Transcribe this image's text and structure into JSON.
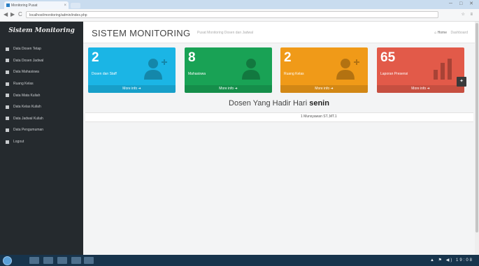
{
  "browser": {
    "tab_title": "Monitoring Pusat",
    "tab_close": "×",
    "url": "localhost/monitoring/admin/index.php",
    "window_controls": "─ □ ✕",
    "nav_back": "◀",
    "nav_forward": "▶",
    "reload": "C",
    "addr_right_icons": "☆ ≡"
  },
  "sidebar": {
    "brand": "Sistem Monitoring",
    "items": [
      {
        "label": "Data Dosen Tetap"
      },
      {
        "label": "Data Dosen Jadwal"
      },
      {
        "label": "Data Mahasiswa"
      },
      {
        "label": "Ruang Kelas"
      },
      {
        "label": "Data Mata Kuliah"
      },
      {
        "label": "Data Kelas Kuliah"
      },
      {
        "label": "Data Jadwal Kuliah"
      },
      {
        "label": "Data Pengumuman"
      },
      {
        "label": "Logout"
      }
    ]
  },
  "header": {
    "title": "SISTEM MONITORING",
    "subtitle": "Pusat Monitoring Dosen dan Jadwal",
    "home_link": "⌂ Home",
    "breadcrumb_current": "Dashboard"
  },
  "stats": [
    {
      "value": "2",
      "label": "Dosen dan Staff",
      "footer": "More info ➜",
      "color": "#1bb5e5"
    },
    {
      "value": "8",
      "label": "Mahasiswa",
      "footer": "More info ➜",
      "color": "#19a255"
    },
    {
      "value": "2",
      "label": "Ruang Kelas",
      "footer": "More info ➜",
      "color": "#f09a18"
    },
    {
      "value": "65",
      "label": "Laporan Presensi",
      "footer": "More info ➜",
      "color": "#e25a49"
    }
  ],
  "panel": {
    "title_prefix": "Dosen Yang Hadir Hari",
    "title_day": "senin",
    "row_text": "1 Munsyawan ST.,MT.1"
  },
  "float_button": "✦",
  "taskbar": {
    "tray_text": "▲ ⚑ ◀) 19:08"
  }
}
